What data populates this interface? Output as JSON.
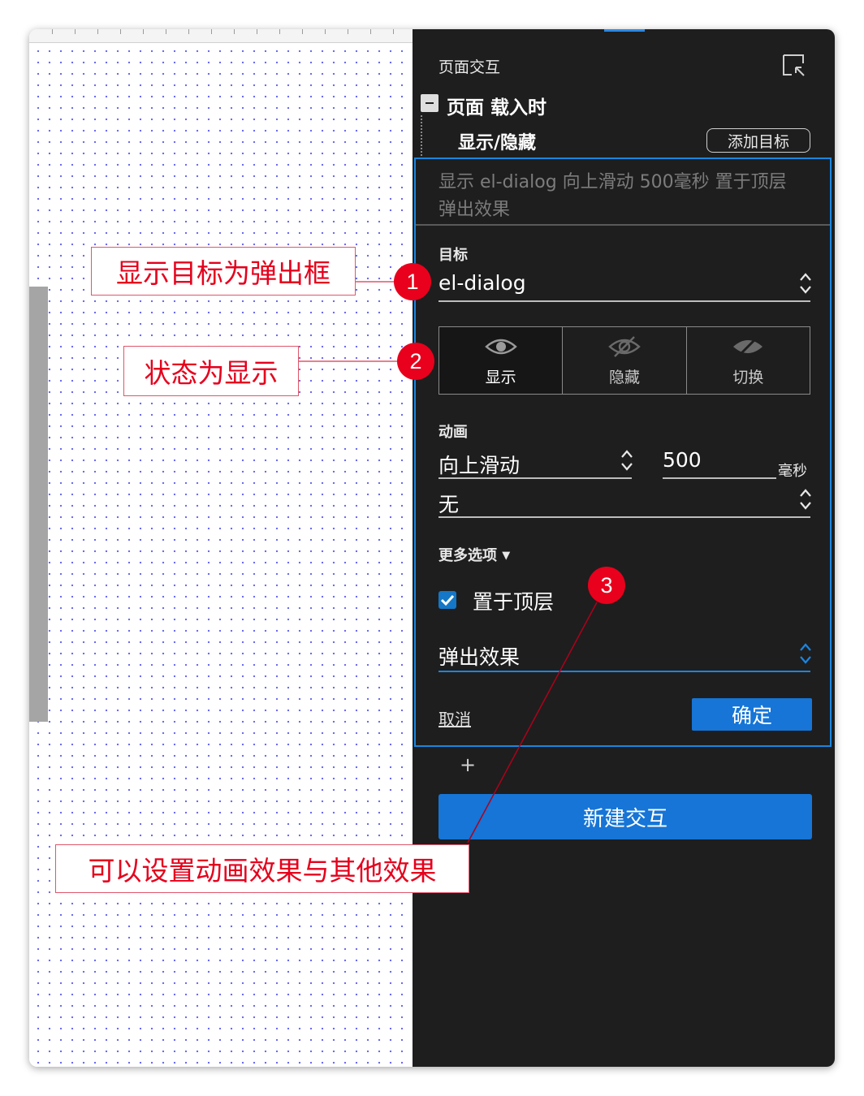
{
  "panel": {
    "title": "页面交互",
    "event_label": "页面 载入时",
    "action_label": "显示/隐藏",
    "add_target_label": "添加目标",
    "summary_line1": "显示 el-dialog 向上滑动 500毫秒 置于顶层",
    "summary_line2": "弹出效果",
    "target": {
      "label": "目标",
      "value": "el-dialog"
    },
    "state": {
      "options": [
        "显示",
        "隐藏",
        "切换"
      ],
      "selected": "显示"
    },
    "animation": {
      "label": "动画",
      "type": "向上滑动",
      "duration": "500",
      "unit": "毫秒",
      "easing": "无"
    },
    "more_options": {
      "label": "更多选项",
      "toggle_icon": "triangle-down-icon"
    },
    "bring_to_front": {
      "label": "置于顶层",
      "checked": true
    },
    "effect": {
      "value": "弹出效果"
    },
    "cancel_label": "取消",
    "ok_label": "确定",
    "plus_label": "+",
    "new_interaction_label": "新建交互"
  },
  "annotations": [
    {
      "number": "1",
      "text": "显示目标为弹出框"
    },
    {
      "number": "2",
      "text": "状态为显示"
    },
    {
      "number": "3",
      "text": "可以设置动画效果与其他效果"
    }
  ],
  "colors": {
    "panel_bg": "#1e1e1e",
    "accent_blue": "#1675d6",
    "focus_border": "#1a86e0",
    "annotation_red": "#e8001c",
    "canvas_dot": "#6c6cf0"
  }
}
